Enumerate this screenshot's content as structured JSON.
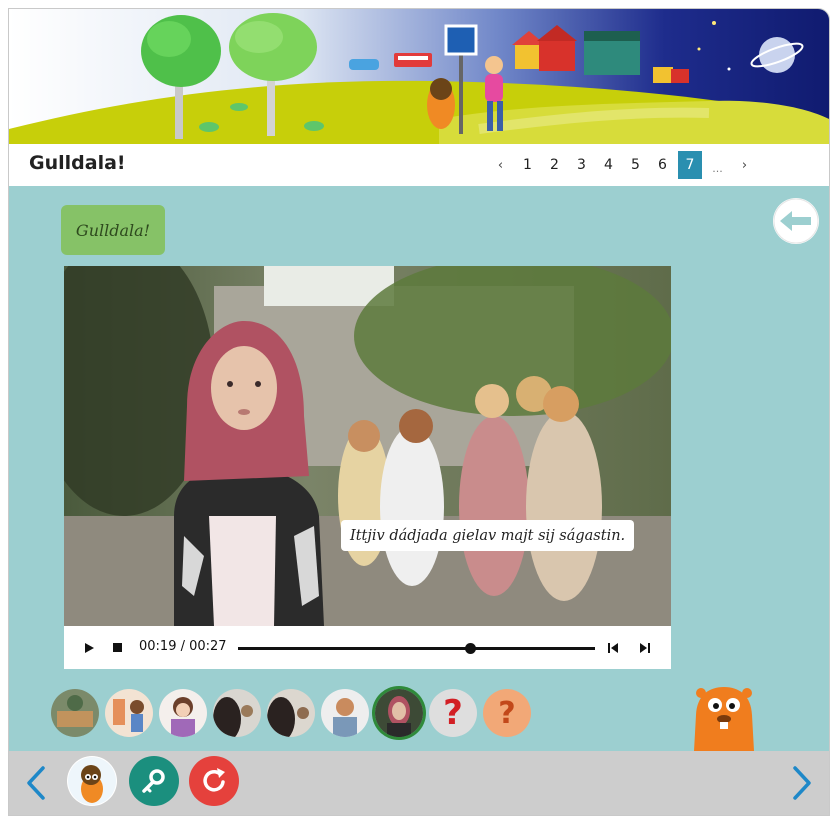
{
  "header": {
    "title": "Gulldala!",
    "pagination": {
      "prev": "‹",
      "pages": [
        "1",
        "2",
        "3",
        "4",
        "5",
        "6",
        "7"
      ],
      "current": "7",
      "ellipsis": "...",
      "next": "›"
    }
  },
  "content": {
    "bubble_text": "Gulldala!",
    "back_button_icon": "arrow-left-icon",
    "video": {
      "subtitle": "Ittjiv dádjada gielav majt sij ságastin.",
      "time": "00:19 / 00:27",
      "progress": 0.65,
      "controls": [
        "play-icon",
        "stop-icon",
        "skip-back-icon",
        "skip-forward-icon"
      ]
    }
  },
  "thumbnails": [
    {
      "name": "scene-1",
      "kind": "image"
    },
    {
      "name": "scene-2",
      "kind": "image"
    },
    {
      "name": "scene-3",
      "kind": "image"
    },
    {
      "name": "scene-4",
      "kind": "image"
    },
    {
      "name": "scene-5",
      "kind": "image"
    },
    {
      "name": "scene-6",
      "kind": "image"
    },
    {
      "name": "scene-7",
      "kind": "image",
      "selected": true
    },
    {
      "name": "question",
      "kind": "question",
      "label": "?"
    },
    {
      "name": "question-mix",
      "kind": "question",
      "label": "?"
    }
  ],
  "bottom_bar": {
    "prev_icon": "chevron-left-icon",
    "next_icon": "chevron-right-icon",
    "buttons": [
      "avatar-icon",
      "key-icon",
      "restart-icon"
    ]
  },
  "colors": {
    "background": "#9ccfd0",
    "pager_active": "#2a8fb0",
    "bubble": "#86c267",
    "key_button": "#1b8f7e",
    "restart_button": "#e5413c",
    "nav_arrow": "#1e88c8",
    "selected_thumb": "#2f8a3a"
  }
}
